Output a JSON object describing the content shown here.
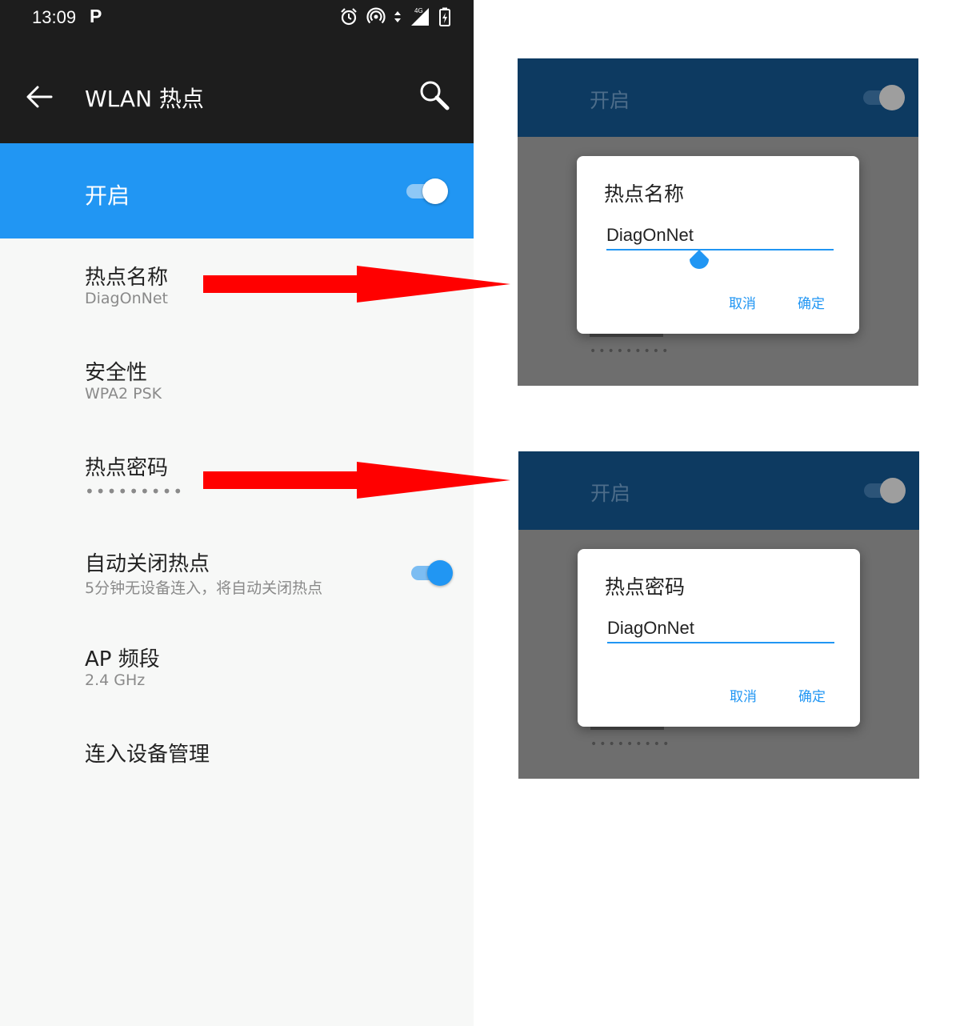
{
  "status_bar": {
    "time": "13:09",
    "notification": "P",
    "icons": [
      "alarm-icon",
      "hotspot-icon",
      "data-arrows-icon",
      "signal-4g-icon",
      "battery-icon"
    ],
    "network_type": "4G"
  },
  "app_bar": {
    "title": "WLAN 热点",
    "icons": [
      "back-arrow-icon",
      "search-icon"
    ]
  },
  "master_switch": {
    "label": "开启",
    "on": true
  },
  "settings": [
    {
      "title": "热点名称",
      "subtitle": "DiagOnNet"
    },
    {
      "title": "安全性",
      "subtitle": "WPA2 PSK"
    },
    {
      "title": "热点密码",
      "subtitle": "•••••••••"
    },
    {
      "title": "自动关闭热点",
      "subtitle": "5分钟无设备连入，将自动关闭热点",
      "toggle_on": true
    },
    {
      "title": "AP 频段",
      "subtitle": "2.4 GHz"
    },
    {
      "title": "连入设备管理"
    }
  ],
  "zoom_panels": [
    {
      "background_label": "开启",
      "behind_dots": "•••••••••",
      "dialog": {
        "title": "热点名称",
        "value": "DiagOnNet",
        "cancel": "取消",
        "ok": "确定"
      }
    },
    {
      "background_label": "开启",
      "behind_dots": "•••••••••",
      "dialog": {
        "title": "热点密码",
        "value": "DiagOnNet",
        "cancel": "取消",
        "ok": "确定"
      }
    }
  ],
  "colors": {
    "accent": "#2196f3",
    "app_bar": "#1d1d1d",
    "arrow": "#ff0000",
    "panel_header": "#0d3a61",
    "scrim": "#6e6e6e"
  }
}
